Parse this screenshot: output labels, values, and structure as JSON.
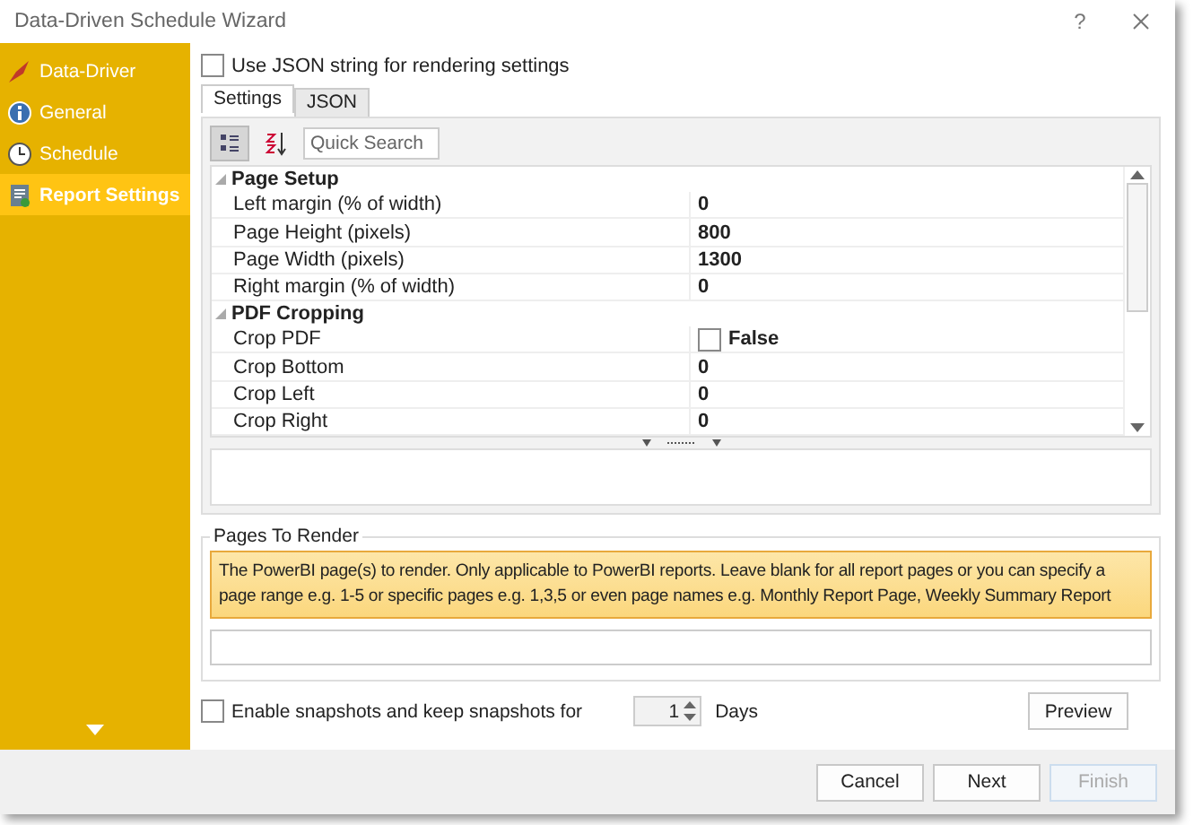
{
  "window": {
    "title": "Data-Driven Schedule Wizard",
    "help": "?"
  },
  "sidebar": {
    "items": [
      {
        "label": "Data-Driver",
        "selected": false
      },
      {
        "label": "General",
        "selected": false
      },
      {
        "label": "Schedule",
        "selected": false
      },
      {
        "label": "Report Settings",
        "selected": true
      }
    ]
  },
  "use_json": {
    "label": "Use JSON string for rendering settings",
    "checked": false
  },
  "tabs": [
    {
      "label": "Settings",
      "selected": true
    },
    {
      "label": "JSON",
      "selected": false
    }
  ],
  "toolbar": {
    "categorized_selected": true,
    "alphabetical_selected": false,
    "search_placeholder": "Quick Search"
  },
  "grid": {
    "categories": [
      {
        "name": "Page Setup",
        "expanded": true,
        "rows": [
          {
            "kind": "text",
            "name": "Left margin (% of width)",
            "value": "0"
          },
          {
            "kind": "text",
            "name": "Page Height (pixels)",
            "value": "800"
          },
          {
            "kind": "text",
            "name": "Page Width (pixels)",
            "value": "1300"
          },
          {
            "kind": "text",
            "name": "Right margin (% of width)",
            "value": "0"
          }
        ]
      },
      {
        "name": "PDF Cropping",
        "expanded": true,
        "rows": [
          {
            "kind": "checkbox",
            "name": "Crop PDF",
            "value": "False",
            "checked": false
          },
          {
            "kind": "text",
            "name": "Crop Bottom",
            "value": "0"
          },
          {
            "kind": "text",
            "name": "Crop Left",
            "value": "0"
          },
          {
            "kind": "text",
            "name": "Crop Right",
            "value": "0"
          }
        ]
      }
    ]
  },
  "pages_to_render": {
    "title": "Pages To Render",
    "info": "The PowerBI page(s) to render. Only applicable to PowerBI reports. Leave blank for all report pages or you can specify a page range e.g. 1-5 or specific pages e.g. 1,3,5 or even page names e.g. Monthly Report Page, Weekly Summary Report"
  },
  "snapshots": {
    "label": "Enable snapshots and keep snapshots for",
    "checked": false,
    "days_value": "1",
    "days_label": "Days"
  },
  "preview_button": "Preview",
  "buttons": [
    {
      "label": "Cancel",
      "disabled": false
    },
    {
      "label": "Next",
      "disabled": false
    },
    {
      "label": "Finish",
      "disabled": true
    }
  ]
}
